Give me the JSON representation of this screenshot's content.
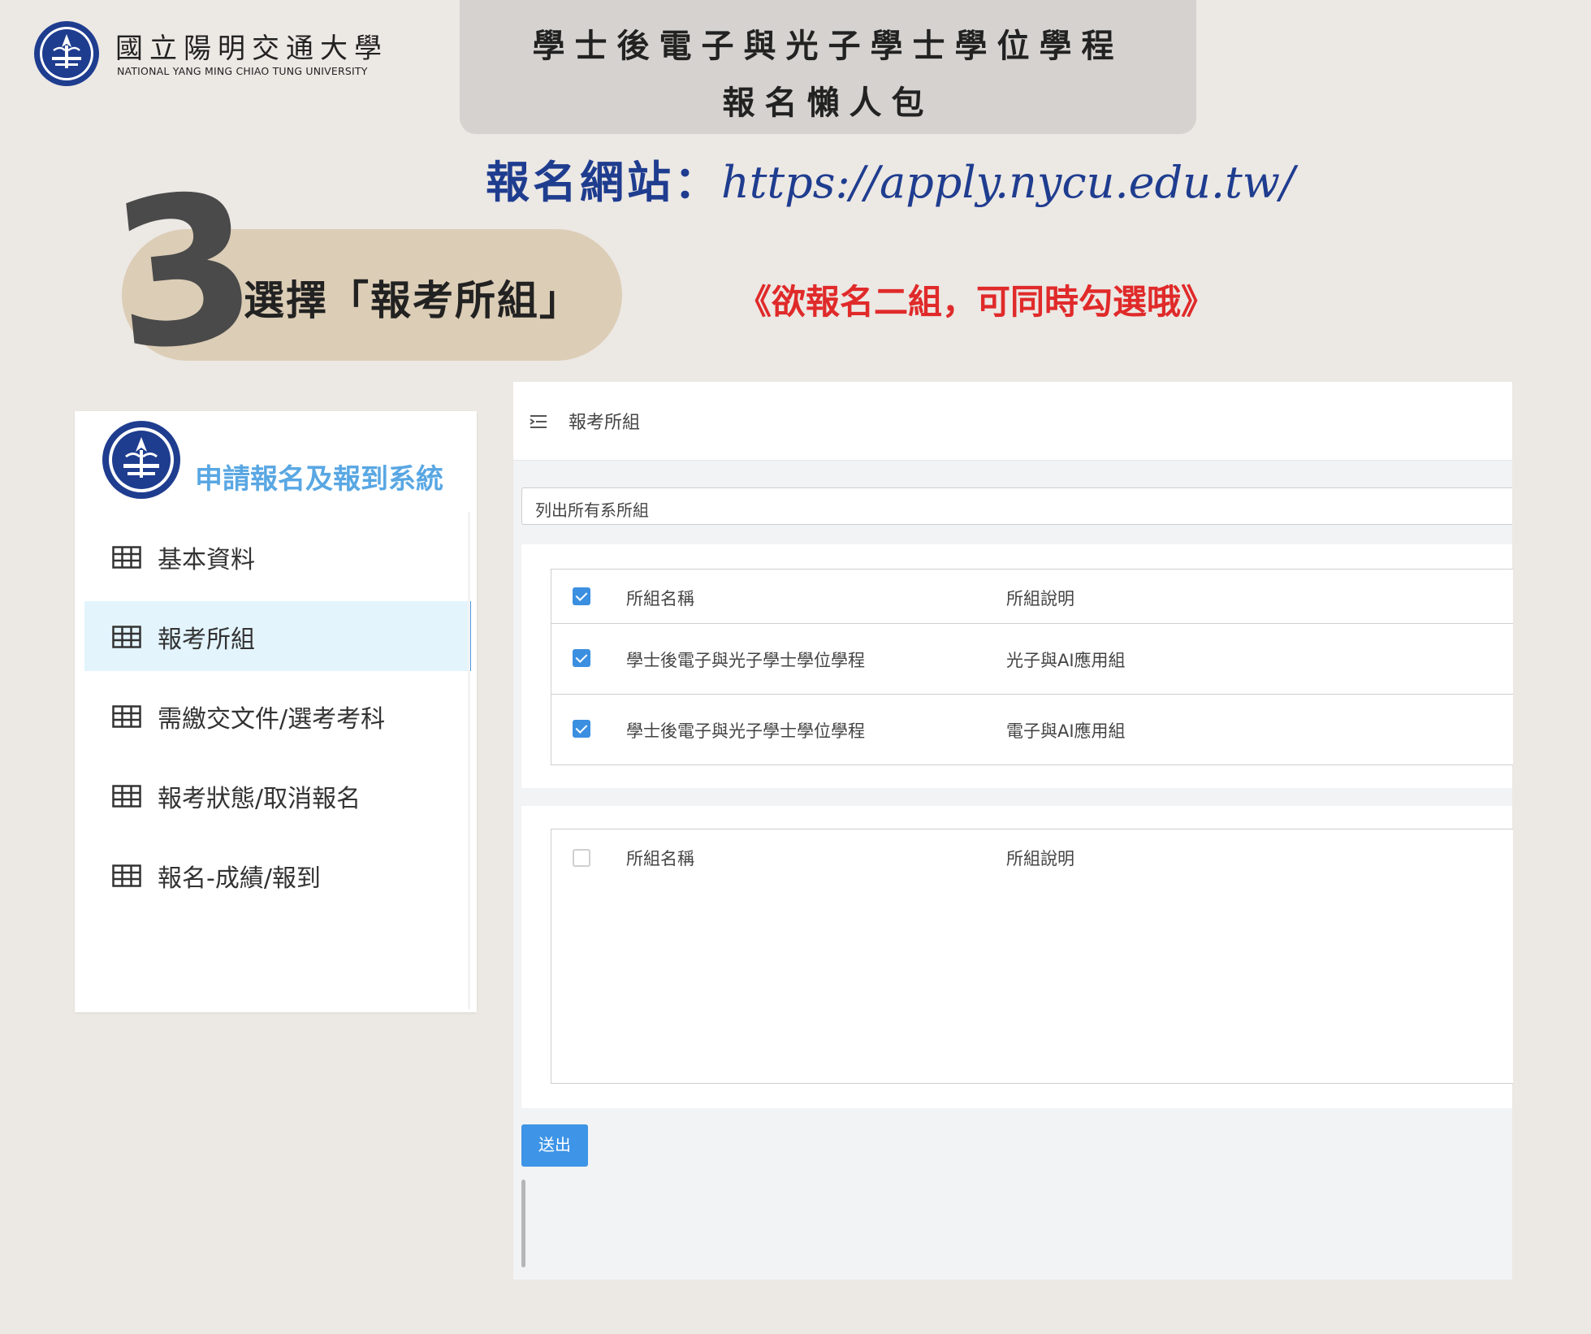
{
  "university": {
    "name_zh": "國立陽明交通大學",
    "name_en": "NATIONAL YANG MING CHIAO TUNG UNIVERSITY"
  },
  "banner": {
    "line1": "學士後電子與光子學士學位學程",
    "line2": "報名懶人包"
  },
  "url": {
    "label": "報名網站：",
    "text": "https://apply.nycu.edu.tw/"
  },
  "step": {
    "number": "3",
    "text": "選擇「報考所組」",
    "note": "《欲報名二組，可同時勾選哦》"
  },
  "sidebar": {
    "title": "申請報名及報到系統",
    "items": [
      {
        "label": "基本資料",
        "active": false
      },
      {
        "label": "報考所組",
        "active": true
      },
      {
        "label": "需繳交文件/選考考科",
        "active": false
      },
      {
        "label": "報考狀態/取消報名",
        "active": false
      },
      {
        "label": "報名-成績/報到",
        "active": false
      }
    ]
  },
  "main": {
    "page_title": "報考所組",
    "filter_value": "列出所有系所組",
    "selected_table": {
      "header": {
        "col1": "所組名稱",
        "col2": "所組說明",
        "checked": true
      },
      "rows": [
        {
          "col1": "學士後電子與光子學士學位學程",
          "col2": "光子與AI應用組",
          "checked": true
        },
        {
          "col1": "學士後電子與光子學士學位學程",
          "col2": "電子與AI應用組",
          "checked": true
        }
      ]
    },
    "available_table": {
      "header": {
        "col1": "所組名稱",
        "col2": "所組說明",
        "checked": false
      },
      "rows": []
    },
    "submit_label": "送出"
  },
  "colors": {
    "page_bg": "#ece8e4",
    "url_blue": "#1f3d8f",
    "note_red": "#e02a2a",
    "accent_blue": "#3e94e6",
    "sidebar_title": "#59a7e3",
    "pill": "#dccdb6"
  }
}
